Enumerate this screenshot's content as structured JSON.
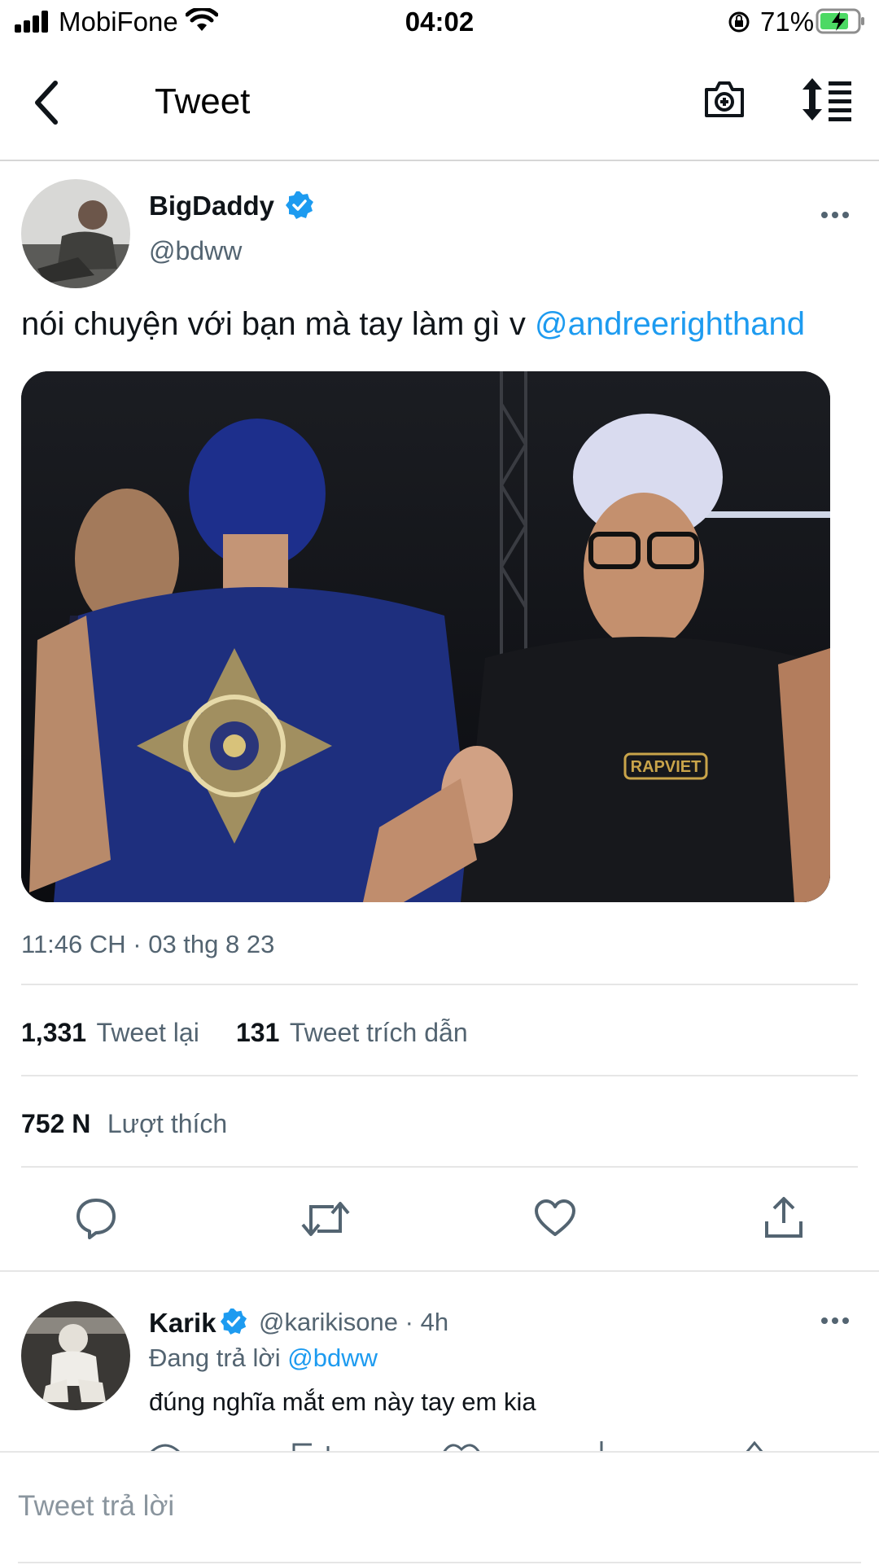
{
  "status_bar": {
    "carrier": "MobiFone",
    "time": "04:02",
    "battery_percent": "71%",
    "icons": [
      "signal-icon",
      "wifi-icon",
      "orientation-lock-icon",
      "battery-charging-icon"
    ]
  },
  "nav": {
    "title": "Tweet",
    "icons": [
      "back-icon",
      "camera-add-icon",
      "sort-icon"
    ]
  },
  "tweet": {
    "author_name": "BigDaddy",
    "author_handle": "@bdww",
    "text": "nói chuyện với bạn mà tay làm gì v ",
    "mention": "@andreerighthand",
    "shirt_logo": "RAPVIET",
    "timestamp": "11:46 CH · 03 thg 8 23",
    "retweets_count": "1,331",
    "retweets_label": "Tweet lại",
    "quotes_count": "131",
    "quotes_label": "Tweet trích dẫn",
    "likes_count": "752 N",
    "likes_label": "Lượt thích",
    "actions": [
      "reply-icon",
      "retweet-icon",
      "like-icon",
      "share-icon"
    ]
  },
  "reply": {
    "author_name": "Karik",
    "author_handle": "@karikisone",
    "time": "· 4h",
    "replying_prefix": "Đang trả lời",
    "replying_to": "@bdww",
    "text": "đúng nghĩa mắt em này tay em kia"
  },
  "composer": {
    "placeholder": "Tweet trả lời"
  },
  "colors": {
    "accent": "#1d9bf0",
    "secondary_text": "#536471",
    "primary_text": "#0f1419"
  }
}
